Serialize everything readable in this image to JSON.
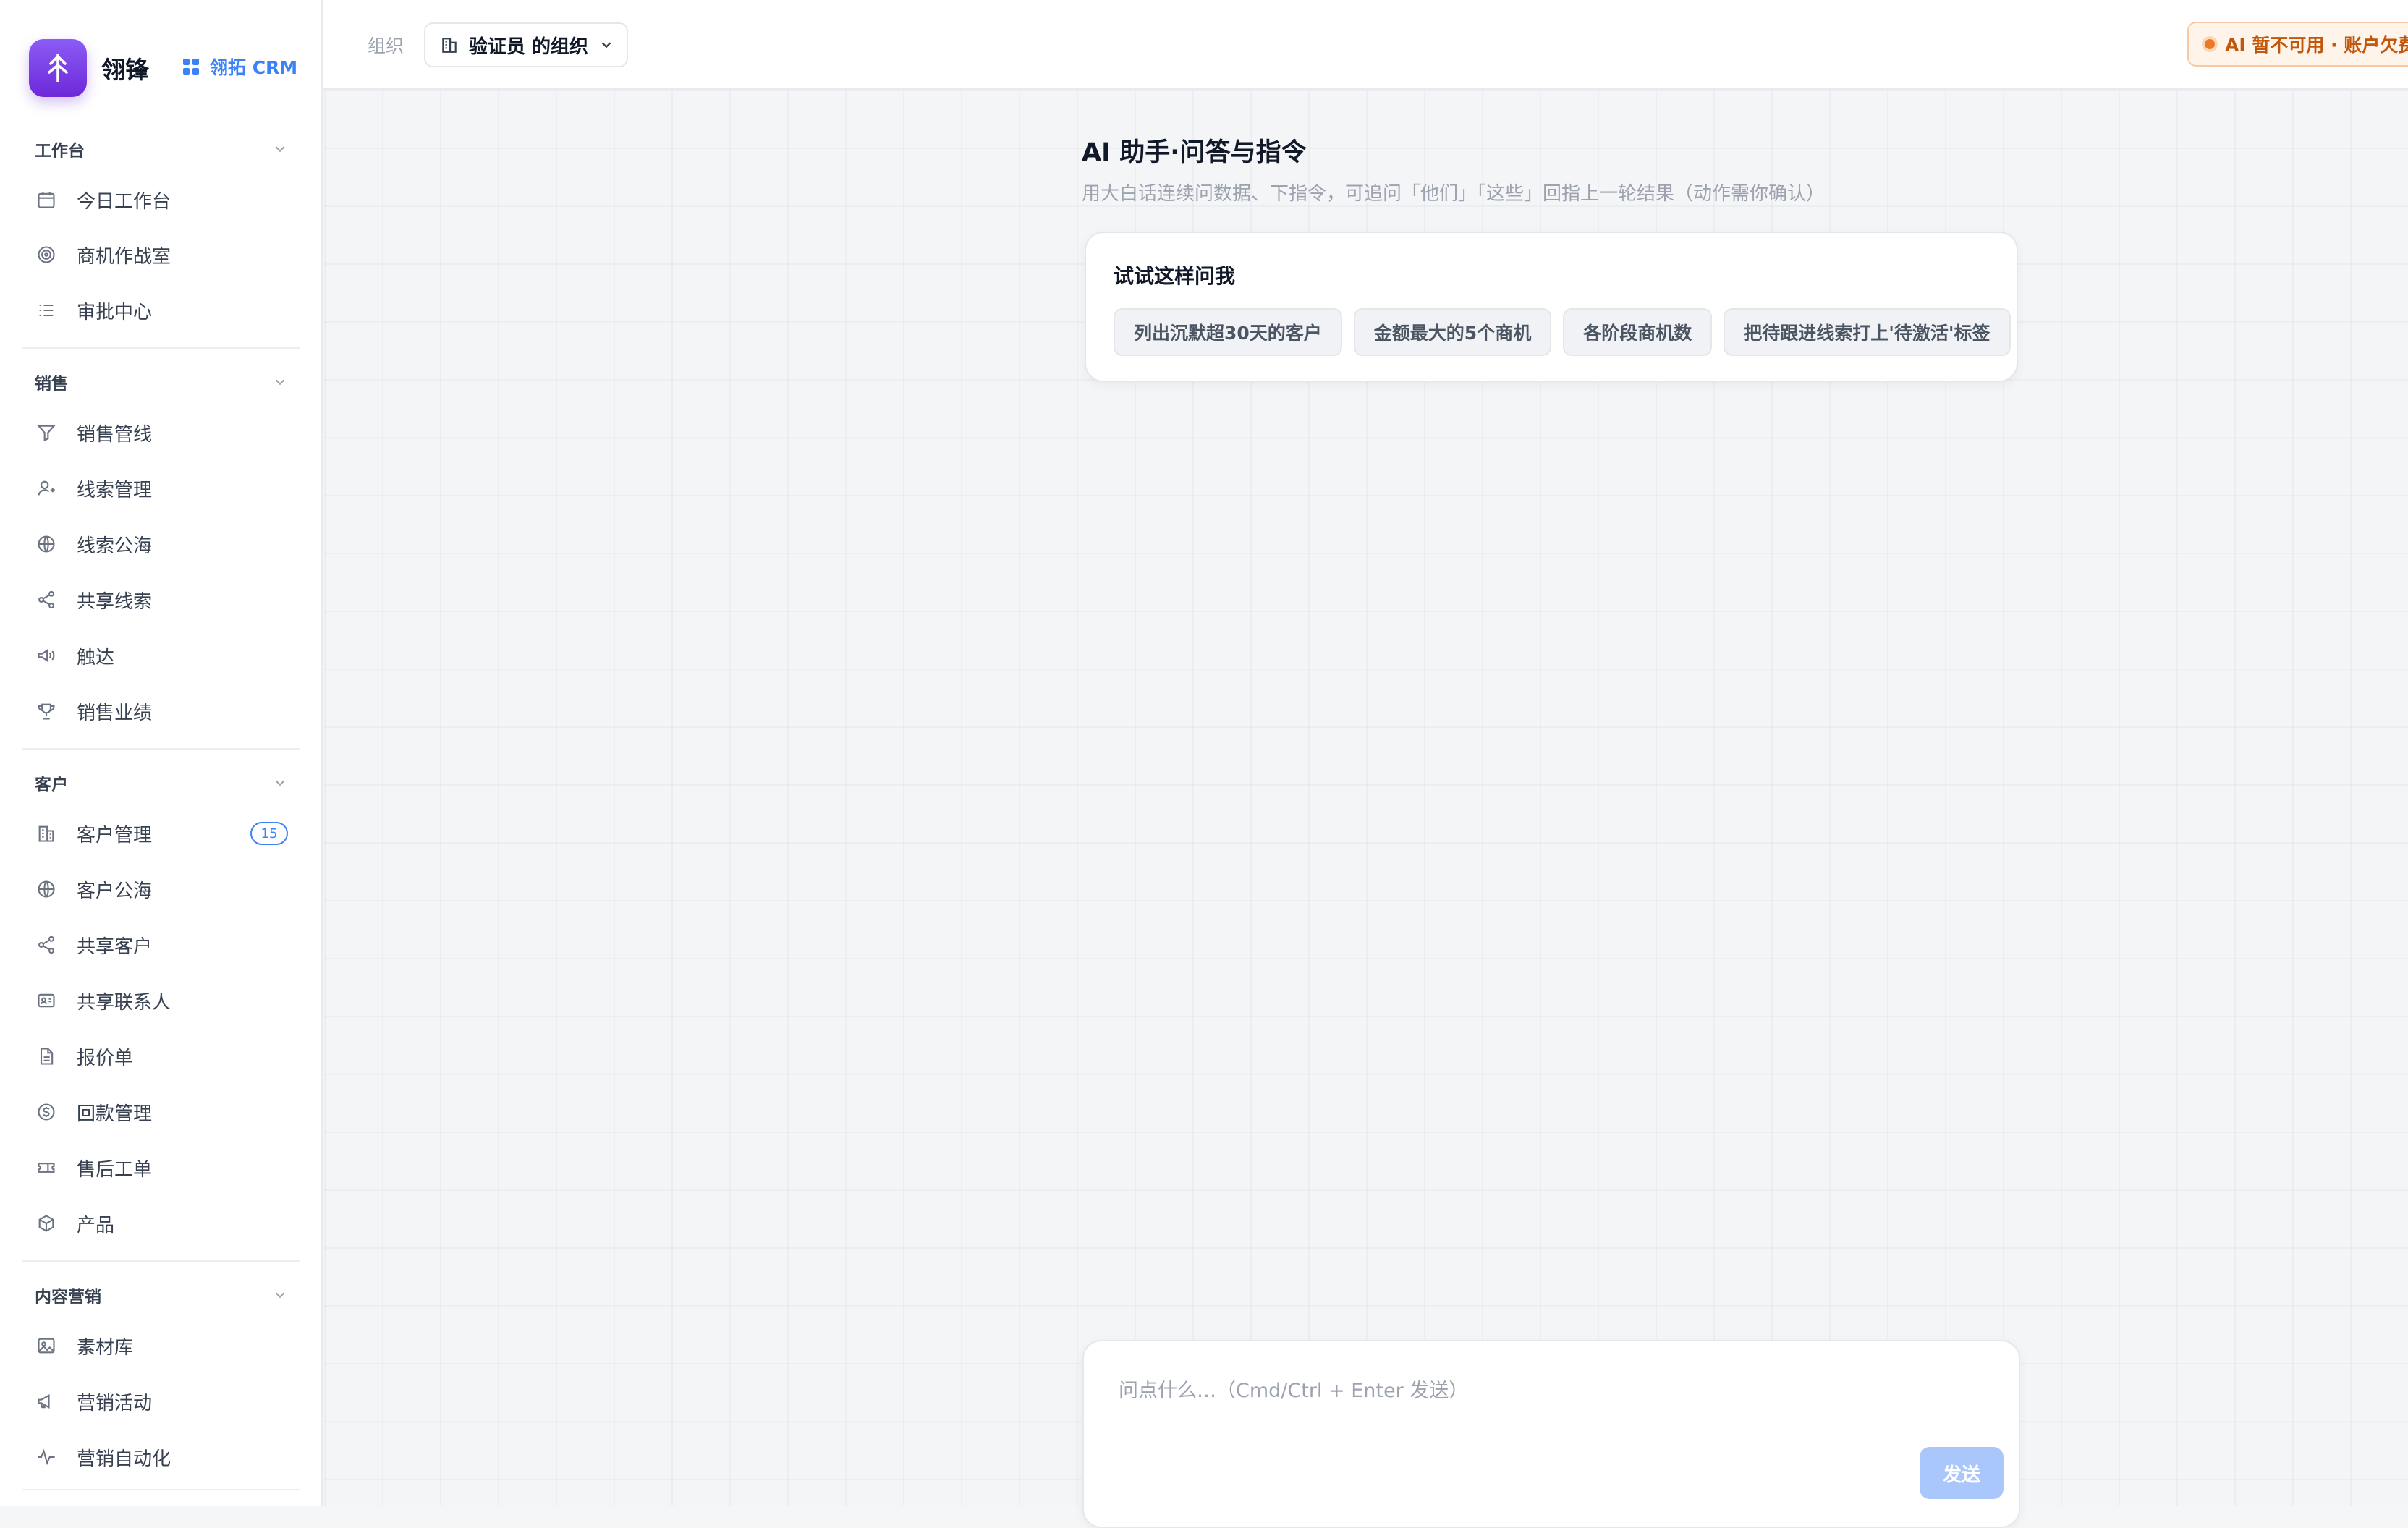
{
  "brand": {
    "name": "翎锋",
    "crm_label": "翎拓 CRM"
  },
  "sidebar": {
    "sections": [
      {
        "title": "工作台",
        "items": [
          {
            "label": "今日工作台",
            "icon": "calendar-icon"
          },
          {
            "label": "商机作战室",
            "icon": "target-icon"
          },
          {
            "label": "审批中心",
            "icon": "list-check-icon"
          }
        ]
      },
      {
        "title": "销售",
        "items": [
          {
            "label": "销售管线",
            "icon": "funnel-icon"
          },
          {
            "label": "线索管理",
            "icon": "user-icon"
          },
          {
            "label": "线索公海",
            "icon": "globe-icon"
          },
          {
            "label": "共享线索",
            "icon": "share-icon"
          },
          {
            "label": "触达",
            "icon": "megaphone-icon"
          },
          {
            "label": "销售业绩",
            "icon": "trophy-icon"
          }
        ]
      },
      {
        "title": "客户",
        "items": [
          {
            "label": "客户管理",
            "icon": "building-icon",
            "badge": "15"
          },
          {
            "label": "客户公海",
            "icon": "globe-icon"
          },
          {
            "label": "共享客户",
            "icon": "share-icon"
          },
          {
            "label": "共享联系人",
            "icon": "id-card-icon"
          },
          {
            "label": "报价单",
            "icon": "document-icon"
          },
          {
            "label": "回款管理",
            "icon": "dollar-circle-icon"
          },
          {
            "label": "售后工单",
            "icon": "ticket-icon"
          },
          {
            "label": "产品",
            "icon": "box-icon"
          }
        ]
      },
      {
        "title": "内容营销",
        "items": [
          {
            "label": "素材库",
            "icon": "image-icon"
          },
          {
            "label": "营销活动",
            "icon": "megaphone-icon"
          },
          {
            "label": "营销自动化",
            "icon": "activity-icon"
          }
        ]
      }
    ]
  },
  "topbar": {
    "org_label": "组织",
    "org_value": "验证员 的组织",
    "ai_status": "AI 暂不可用 · 账户欠费"
  },
  "main": {
    "title": "AI 助手·问答与指令",
    "subtitle": "用大白话连续问数据、下指令，可追问「他们」「这些」回指上一轮结果（动作需你确认）",
    "suggest_title": "试试这样问我",
    "suggestions": [
      "列出沉默超30天的客户",
      "金额最大的5个商机",
      "各阶段商机数",
      "把待跟进线索打上'待激活'标签"
    ],
    "input_placeholder": "问点什么…（Cmd/Ctrl + Enter 发送）",
    "input_value": "",
    "send_label": "发送"
  },
  "colors": {
    "accent": "#3b82f6",
    "brand_purple": "#7c3aed",
    "warning": "#c2570c",
    "send_disabled": "#a9c7fb"
  }
}
